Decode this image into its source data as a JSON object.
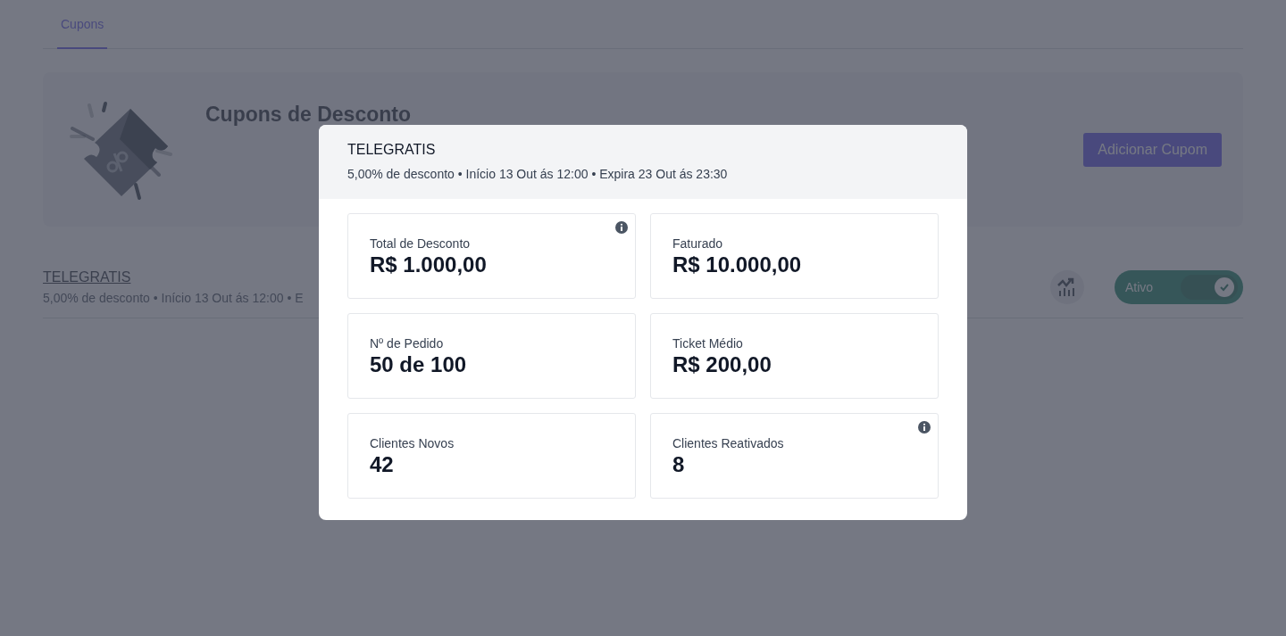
{
  "tabs": [
    {
      "label": "Cupons",
      "selected": true
    }
  ],
  "banner": {
    "title": "Cupons de Desconto",
    "button": "Adicionar Cupom"
  },
  "coupons": [
    {
      "code": "TELEGRATIS",
      "details": "5,00% de desconto • Início 13 Out ás 12:00 • E",
      "status_label": "Ativo",
      "on": true
    }
  ],
  "modal": {
    "title": "TELEGRATIS",
    "details": "5,00% de desconto • Início 13 Out ás 12:00 • Expira 23 Out ás 23:30",
    "metrics": [
      {
        "label": "Total de Desconto",
        "value": "R$ 1.000,00",
        "info": true
      },
      {
        "label": "Faturado",
        "value": "R$ 10.000,00",
        "info": false
      },
      {
        "label": "Nº de Pedido",
        "value": "50 de 100",
        "info": false
      },
      {
        "label": "Ticket Médio",
        "value": "R$ 200,00",
        "info": false
      },
      {
        "label": "Clientes Novos",
        "value": "42",
        "info": false
      },
      {
        "label": "Clientes Reativados",
        "value": "8",
        "info": true
      }
    ]
  }
}
